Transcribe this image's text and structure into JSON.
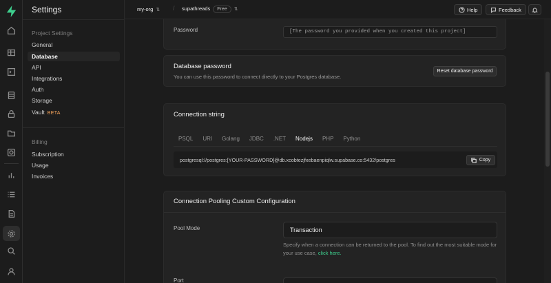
{
  "sidebar": {
    "title": "Settings",
    "groups": [
      {
        "label": "Project Settings",
        "items": [
          "General",
          "Database",
          "API",
          "Integrations",
          "Auth",
          "Storage",
          "Vault"
        ]
      },
      {
        "label": "Billing",
        "items": [
          "Subscription",
          "Usage",
          "Invoices"
        ]
      }
    ],
    "active_item": "Database",
    "vault_badge": "BETA"
  },
  "rail_icons": [
    "supabase-logo-icon",
    "home-icon",
    "table-editor-icon",
    "sql-editor-icon",
    "database-icon",
    "auth-icon",
    "storage-icon",
    "edge-functions-icon",
    "reports-icon",
    "logs-icon",
    "api-docs-icon",
    "settings-icon",
    "search-icon",
    "user-icon"
  ],
  "topbar": {
    "org": "my-org",
    "project": "supathreads",
    "plan_badge": "Free",
    "help_label": "Help",
    "feedback_label": "Feedback"
  },
  "password_field": {
    "label": "Password",
    "placeholder": "[The password you provided when you created this project]"
  },
  "db_password": {
    "title": "Database password",
    "description": "You can use this password to connect directly to your Postgres database.",
    "reset_label": "Reset database password"
  },
  "connection_string": {
    "title": "Connection string",
    "tabs": [
      "PSQL",
      "URI",
      "Golang",
      "JDBC",
      ".NET",
      "Nodejs",
      "PHP",
      "Python"
    ],
    "active_tab": "Nodejs",
    "value": "postgresql://postgres:[YOUR-PASSWORD]@db.xcobtezjfxebaenpiqlw.supabase.co:5432/postgres",
    "copy_label": "Copy"
  },
  "pooling": {
    "title": "Connection Pooling Custom Configuration",
    "pool_mode_label": "Pool Mode",
    "pool_mode_value": "Transaction",
    "help_text": "Specify when a connection can be returned to the pool. To find out the most suitable mode for your use case,",
    "help_link": "click here.",
    "port_label": "Port"
  },
  "colors": {
    "accent": "#3ecf8e",
    "beta": "#f5a35a",
    "background": "#1c1c1c",
    "card": "#232323"
  }
}
